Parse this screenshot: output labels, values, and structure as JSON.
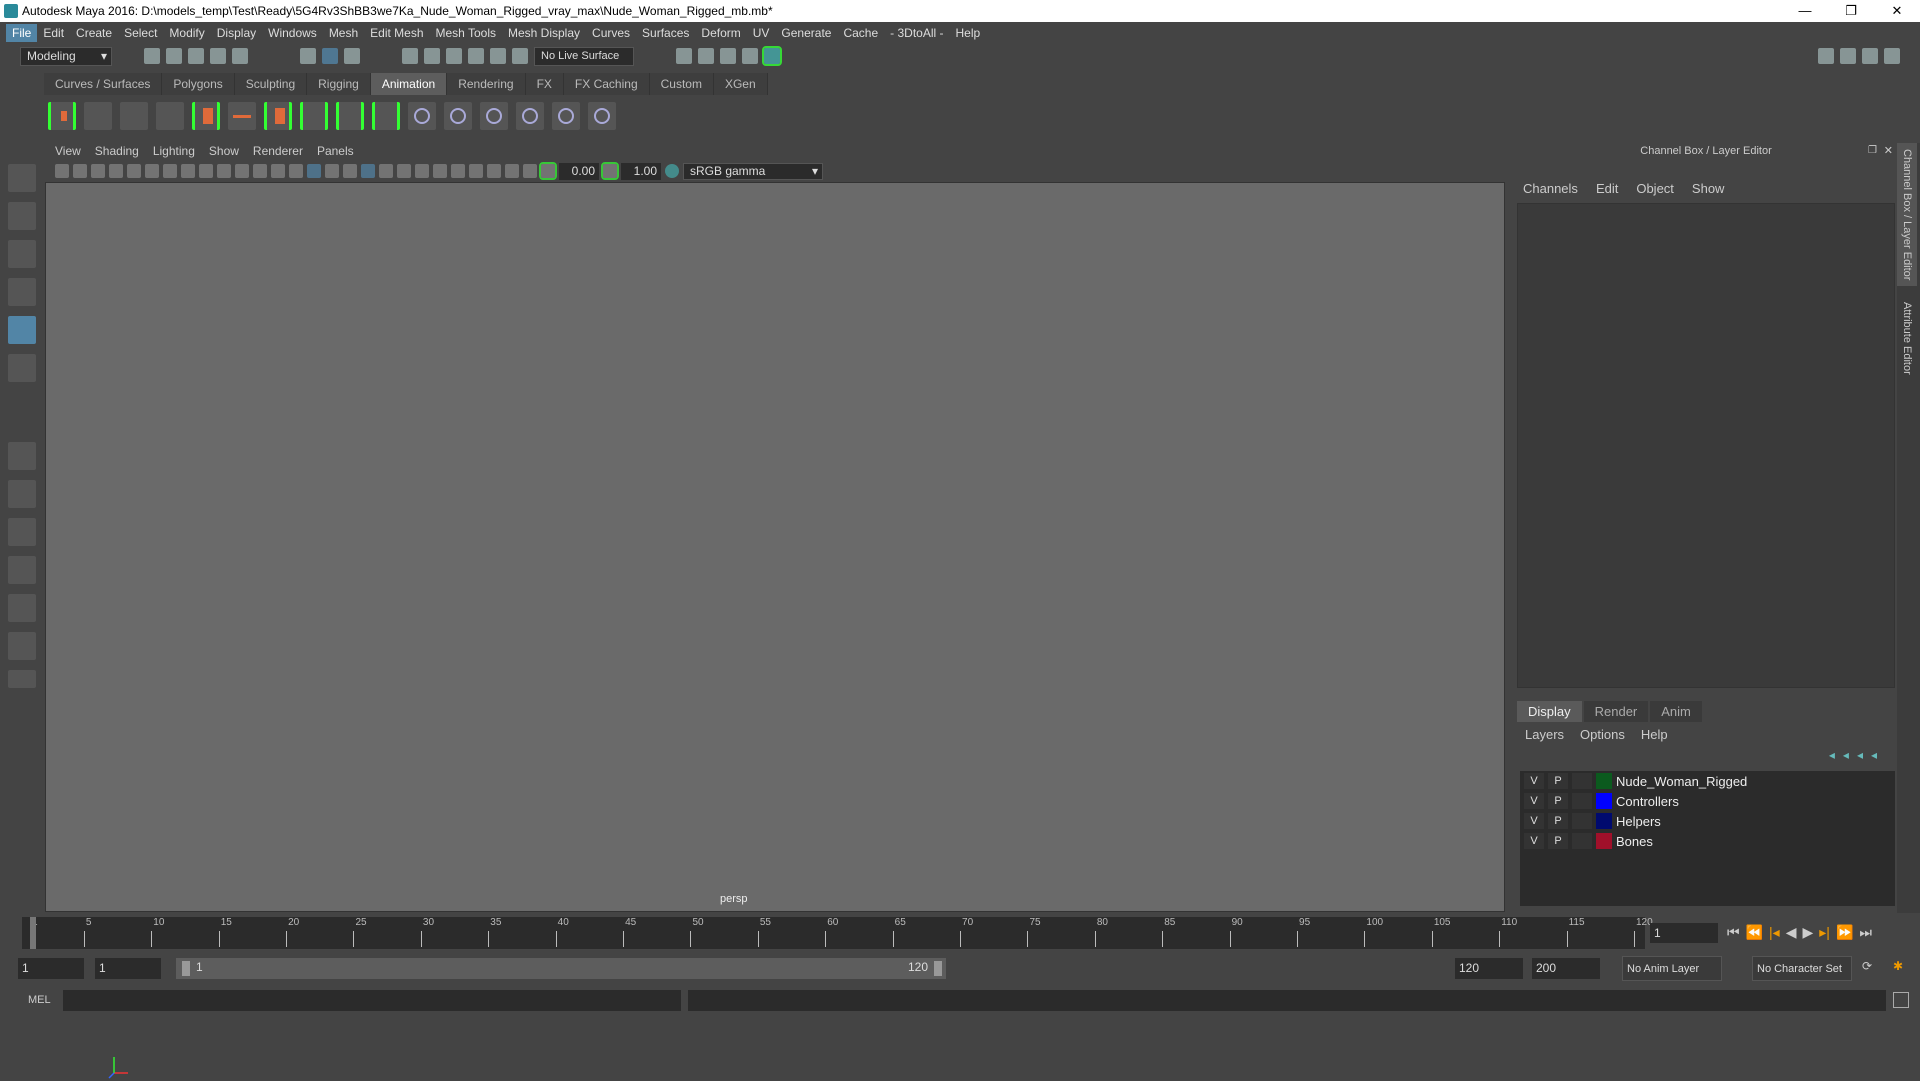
{
  "title": "Autodesk Maya 2016: D:\\models_temp\\Test\\Ready\\5G4Rv3ShBB3we7Ka_Nude_Woman_Rigged_vray_max\\Nude_Woman_Rigged_mb.mb*",
  "window_controls": [
    "—",
    "❐",
    "✕"
  ],
  "menu": [
    "File",
    "Edit",
    "Create",
    "Select",
    "Modify",
    "Display",
    "Windows",
    "Mesh",
    "Edit Mesh",
    "Mesh Tools",
    "Mesh Display",
    "Curves",
    "Surfaces",
    "Deform",
    "UV",
    "Generate",
    "Cache",
    "- 3DtoAll -",
    "Help"
  ],
  "status": {
    "mode": "Modeling",
    "live_surface": "No Live Surface"
  },
  "shelf_tabs": [
    "Curves / Surfaces",
    "Polygons",
    "Sculpting",
    "Rigging",
    "Animation",
    "Rendering",
    "FX",
    "FX Caching",
    "Custom",
    "XGen"
  ],
  "shelf_active": "Animation",
  "viewport": {
    "menu": [
      "View",
      "Shading",
      "Lighting",
      "Show",
      "Renderer",
      "Panels"
    ],
    "exposure": "0.00",
    "gamma": "1.00",
    "color_space": "sRGB gamma",
    "camera": "persp"
  },
  "channel_box": {
    "title": "Channel Box / Layer Editor",
    "menu": [
      "Channels",
      "Edit",
      "Object",
      "Show"
    ]
  },
  "layer_editor": {
    "tabs": [
      "Display",
      "Render",
      "Anim"
    ],
    "menu": [
      "Layers",
      "Options",
      "Help"
    ],
    "layers": [
      {
        "v": "V",
        "p": "P",
        "name": "Nude_Woman_Rigged",
        "color": "#0b5a1e"
      },
      {
        "v": "V",
        "p": "P",
        "name": "Controllers",
        "color": "#0000ff"
      },
      {
        "v": "V",
        "p": "P",
        "name": "Helpers",
        "color": "#000a6e"
      },
      {
        "v": "V",
        "p": "P",
        "name": "Bones",
        "color": "#a0102a"
      }
    ]
  },
  "side_tabs": [
    "Channel Box / Layer Editor",
    "Attribute Editor"
  ],
  "timeline": {
    "labels": [
      "1",
      "5",
      "10",
      "15",
      "20",
      "25",
      "30",
      "35",
      "40",
      "45",
      "50",
      "55",
      "60",
      "65",
      "70",
      "75",
      "80",
      "85",
      "90",
      "95",
      "100",
      "105",
      "110",
      "115",
      "120"
    ],
    "current_frame": "1"
  },
  "range": {
    "start": "1",
    "playback_start": "1",
    "slider_start": "1",
    "slider_end": "120",
    "playback_end": "120",
    "end": "200",
    "anim_layer": "No Anim Layer",
    "character_set": "No Character Set"
  },
  "command_line": {
    "label": "MEL"
  }
}
